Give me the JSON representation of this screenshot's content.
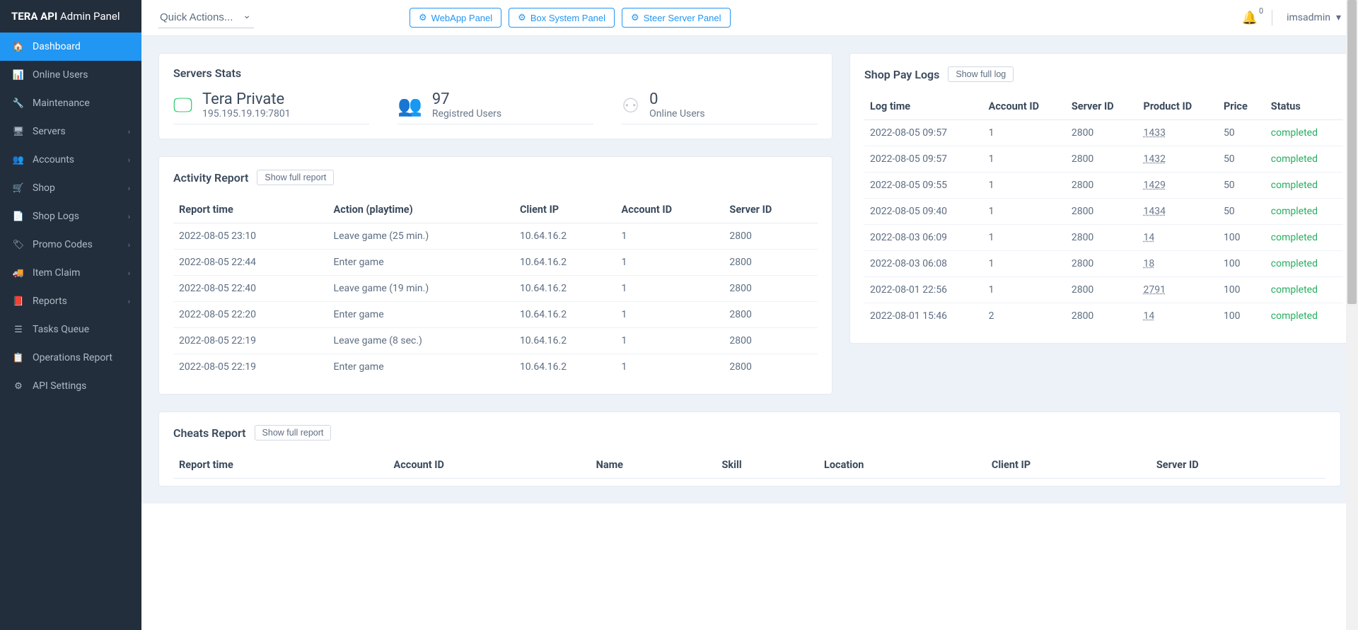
{
  "brand": {
    "bold": "TERA API",
    "rest": " Admin Panel"
  },
  "sidebar": {
    "items": [
      {
        "label": "Dashboard",
        "icon": "🏠",
        "active": true
      },
      {
        "label": "Online Users",
        "icon": "📊",
        "chev": false
      },
      {
        "label": "Maintenance",
        "icon": "🔧",
        "chev": false
      },
      {
        "label": "Servers",
        "icon": "🖥",
        "chev": true
      },
      {
        "label": "Accounts",
        "icon": "👥",
        "chev": true
      },
      {
        "label": "Shop",
        "icon": "🛒",
        "chev": true
      },
      {
        "label": "Shop Logs",
        "icon": "📄",
        "chev": true
      },
      {
        "label": "Promo Codes",
        "icon": "🏷",
        "chev": true
      },
      {
        "label": "Item Claim",
        "icon": "🚚",
        "chev": true
      },
      {
        "label": "Reports",
        "icon": "📕",
        "chev": true
      },
      {
        "label": "Tasks Queue",
        "icon": "☰",
        "chev": false
      },
      {
        "label": "Operations Report",
        "icon": "📋",
        "chev": false
      },
      {
        "label": "API Settings",
        "icon": "⚙",
        "chev": false
      }
    ]
  },
  "topbar": {
    "quick_actions_label": "Quick Actions...",
    "buttons": [
      {
        "label": "WebApp Panel"
      },
      {
        "label": "Box System Panel"
      },
      {
        "label": "Steer Server Panel"
      }
    ],
    "notif_count": "0",
    "username": "imsadmin"
  },
  "servers_stats": {
    "title": "Servers Stats",
    "server_name": "Tera Private",
    "server_addr": "195.195.19.19:7801",
    "registered_count": "97",
    "registered_label": "Registred Users",
    "online_count": "0",
    "online_label": "Online Users"
  },
  "activity": {
    "title": "Activity Report",
    "full_btn": "Show full report",
    "headers": [
      "Report time",
      "Action (playtime)",
      "Client IP",
      "Account ID",
      "Server ID"
    ],
    "rows": [
      [
        "2022-08-05 23:10",
        "Leave game (25 min.)",
        "10.64.16.2",
        "1",
        "2800"
      ],
      [
        "2022-08-05 22:44",
        "Enter game",
        "10.64.16.2",
        "1",
        "2800"
      ],
      [
        "2022-08-05 22:40",
        "Leave game (19 min.)",
        "10.64.16.2",
        "1",
        "2800"
      ],
      [
        "2022-08-05 22:20",
        "Enter game",
        "10.64.16.2",
        "1",
        "2800"
      ],
      [
        "2022-08-05 22:19",
        "Leave game (8 sec.)",
        "10.64.16.2",
        "1",
        "2800"
      ],
      [
        "2022-08-05 22:19",
        "Enter game",
        "10.64.16.2",
        "1",
        "2800"
      ]
    ]
  },
  "shop": {
    "title": "Shop Pay Logs",
    "full_btn": "Show full log",
    "headers": [
      "Log time",
      "Account ID",
      "Server ID",
      "Product ID",
      "Price",
      "Status"
    ],
    "rows": [
      [
        "2022-08-05 09:57",
        "1",
        "2800",
        "1433",
        "50",
        "completed"
      ],
      [
        "2022-08-05 09:57",
        "1",
        "2800",
        "1432",
        "50",
        "completed"
      ],
      [
        "2022-08-05 09:55",
        "1",
        "2800",
        "1429",
        "50",
        "completed"
      ],
      [
        "2022-08-05 09:40",
        "1",
        "2800",
        "1434",
        "50",
        "completed"
      ],
      [
        "2022-08-03 06:09",
        "1",
        "2800",
        "14",
        "100",
        "completed"
      ],
      [
        "2022-08-03 06:08",
        "1",
        "2800",
        "18",
        "100",
        "completed"
      ],
      [
        "2022-08-01 22:56",
        "1",
        "2800",
        "2791",
        "100",
        "completed"
      ],
      [
        "2022-08-01 15:46",
        "2",
        "2800",
        "14",
        "100",
        "completed"
      ]
    ]
  },
  "cheats": {
    "title": "Cheats Report",
    "full_btn": "Show full report",
    "headers": [
      "Report time",
      "Account ID",
      "Name",
      "Skill",
      "Location",
      "Client IP",
      "Server ID"
    ]
  }
}
